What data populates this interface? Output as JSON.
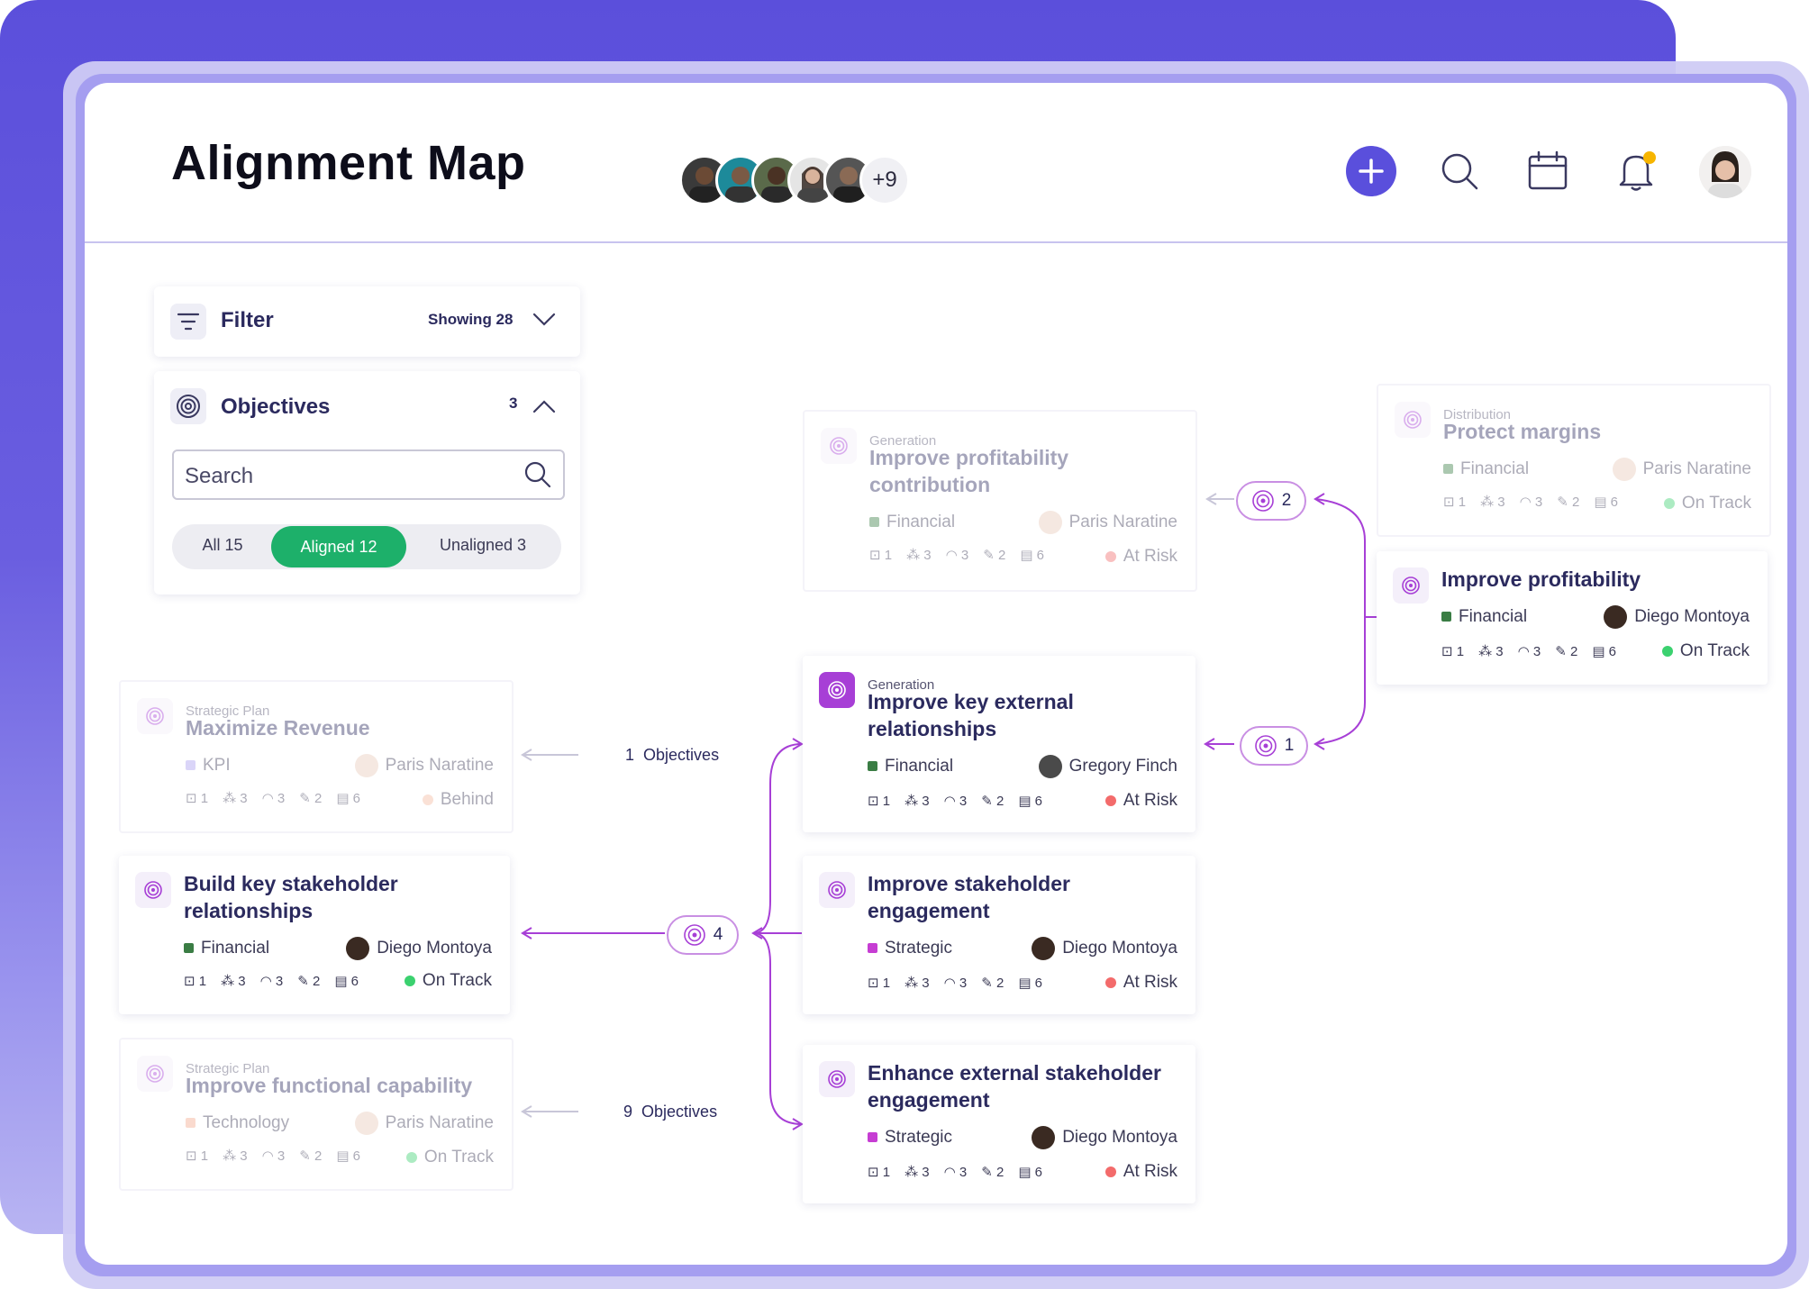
{
  "header": {
    "title": "Alignment Map",
    "avatars_more": "+9"
  },
  "filter": {
    "label": "Filter",
    "showing": "Showing 28"
  },
  "objectives_panel": {
    "label": "Objectives",
    "count": "3",
    "search_placeholder": "Search",
    "segments": [
      "All 15",
      "Aligned 12",
      "Unaligned 3"
    ],
    "active_segment": "Aligned 12"
  },
  "colors": {
    "accent": "#5a4fdc",
    "aligned_green": "#1db06a",
    "connector_purple": "#a73fd6",
    "financial": "#3a7d44",
    "strategic": "#c63dd3",
    "kpi": "#a99cf0",
    "technology": "#f4a98c",
    "on_track": "#3bd16f",
    "at_risk": "#f36b6b",
    "behind": "#f4b9a0"
  },
  "cards": {
    "improve_profitability_contribution": {
      "context": "Generation",
      "title_l1": "Improve profitability",
      "title_l2": "contribution",
      "tag": "Financial",
      "owner": "Paris Naratine",
      "m1": "1",
      "m2": "3",
      "m3": "3",
      "m4": "2",
      "m5": "6",
      "status": "At Risk"
    },
    "protect_margins": {
      "context": "Distribution",
      "title_l1": "Protect margins",
      "tag": "Financial",
      "owner": "Paris Naratine",
      "m1": "1",
      "m2": "3",
      "m3": "3",
      "m4": "2",
      "m5": "6",
      "status": "On Track"
    },
    "improve_profitability": {
      "title_l1": "Improve profitability",
      "tag": "Financial",
      "owner": "Diego Montoya",
      "m1": "1",
      "m2": "3",
      "m3": "3",
      "m4": "2",
      "m5": "6",
      "status": "On Track"
    },
    "improve_key_external": {
      "context": "Generation",
      "title_l1": "Improve key external",
      "title_l2": "relationships",
      "tag": "Financial",
      "owner": "Gregory Finch",
      "m1": "1",
      "m2": "3",
      "m3": "3",
      "m4": "2",
      "m5": "6",
      "status": "At Risk"
    },
    "maximize_revenue": {
      "context": "Strategic Plan",
      "title_l1": "Maximize Revenue",
      "tag": "KPI",
      "owner": "Paris Naratine",
      "m1": "1",
      "m2": "3",
      "m3": "3",
      "m4": "2",
      "m5": "6",
      "status": "Behind"
    },
    "build_key_stakeholder": {
      "title_l1": "Build key stakeholder",
      "title_l2": "relationships",
      "tag": "Financial",
      "owner": "Diego Montoya",
      "m1": "1",
      "m2": "3",
      "m3": "3",
      "m4": "2",
      "m5": "6",
      "status": "On Track"
    },
    "improve_stakeholder_engagement": {
      "title_l1": "Improve stakeholder",
      "title_l2": "engagement",
      "tag": "Strategic",
      "owner": "Diego Montoya",
      "m1": "1",
      "m2": "3",
      "m3": "3",
      "m4": "2",
      "m5": "6",
      "status": "At Risk"
    },
    "improve_functional_capability": {
      "context": "Strategic Plan",
      "title_l1": "Improve functional capability",
      "tag": "Technology",
      "owner": "Paris Naratine",
      "m1": "1",
      "m2": "3",
      "m3": "3",
      "m4": "2",
      "m5": "6",
      "status": "On Track"
    },
    "enhance_external_stakeholder": {
      "title_l1": "Enhance external stakeholder",
      "title_l2": "engagement",
      "tag": "Strategic",
      "owner": "Diego Montoya",
      "m1": "1",
      "m2": "3",
      "m3": "3",
      "m4": "2",
      "m5": "6",
      "status": "At Risk"
    }
  },
  "connectors": {
    "badge_2": "2",
    "badge_1": "1",
    "badge_4": "4",
    "objectives_1_count": "1",
    "objectives_9_count": "9",
    "objectives_word": "Objectives"
  }
}
